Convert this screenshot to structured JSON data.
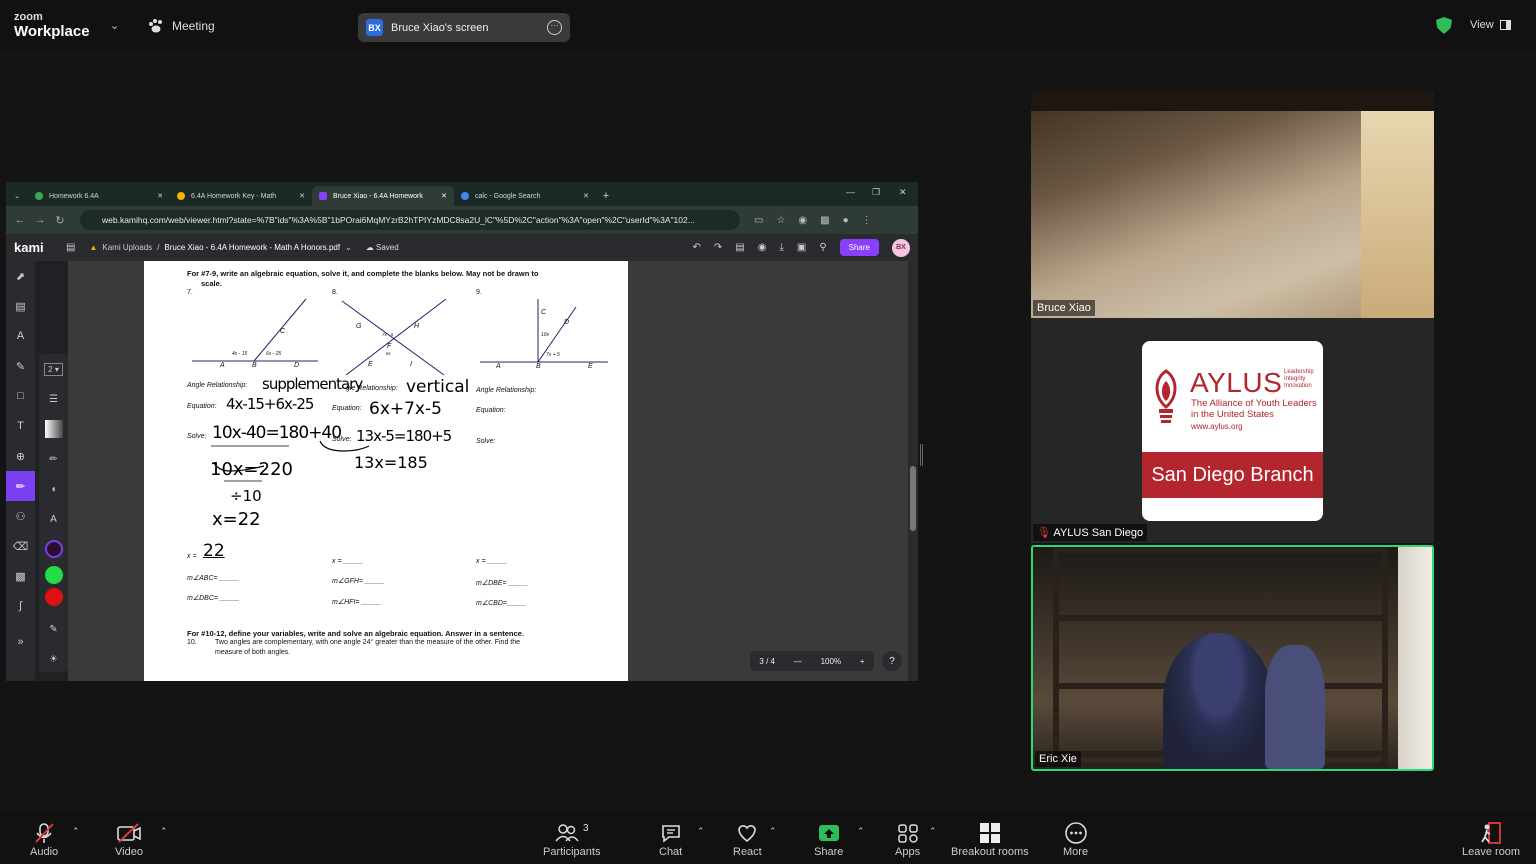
{
  "topbar": {
    "logo_small": "zoom",
    "logo_big": "Workplace",
    "meeting_label": "Meeting",
    "screen_initials": "BX",
    "screen_label": "Bruce Xiao's screen",
    "view_label": "View"
  },
  "browser": {
    "tabs": [
      {
        "label": "Homework 6.4A"
      },
      {
        "label": "6.4A Homework Key - Math"
      },
      {
        "label": "Bruce Xiao - 6.4A Homework"
      },
      {
        "label": "calc - Google Search"
      }
    ],
    "url": "web.kamihq.com/web/viewer.html?state=%7B\"ids\"%3A%5B\"1bPOrai6MqMYzrB2hTPIYzMDC8sa2U_lC\"%5D%2C\"action\"%3A\"open\"%2C\"userId\"%3A\"102..."
  },
  "kami": {
    "logo": "kami",
    "folder": "Kami Uploads",
    "file": "Bruce Xiao - 6.4A Homework - Math A Honors.pdf",
    "saved": "Saved",
    "share": "Share",
    "avatar": "BX",
    "stroke_size": "2",
    "colors": [
      "#2a0e2e",
      "#22dd44",
      "#dd1111"
    ],
    "page_indicator": "3 / 4",
    "zoom": "100%",
    "help": "?"
  },
  "document": {
    "heading": "For #7-9, write an algebraic equation, solve it, and complete the blanks below.  May not be drawn to",
    "heading2": "scale.",
    "nums": [
      "7.",
      "8.",
      "9."
    ],
    "fig7": {
      "left": "4x - 15",
      "right": "6x - 25",
      "pts": [
        "A",
        "B",
        "D",
        "C"
      ]
    },
    "fig8": {
      "top": "7x - 5",
      "bottom": "6x",
      "pts": [
        "G",
        "H",
        "F",
        "E",
        "I"
      ]
    },
    "fig9": {
      "a": "10x",
      "b": "7x + 5",
      "pts": [
        "C",
        "D",
        "A",
        "B",
        "E"
      ]
    },
    "angle_rel": "Angle Relationship:",
    "angle_rel_short": "gle Relationship:",
    "equation": "Equation:",
    "solve": "Solve:",
    "x_eq": "x =",
    "blank": "_____",
    "q7_lines": [
      "m∠ABC= _____",
      "m∠DBC= _____"
    ],
    "q8_lines": [
      "m∠GFH= _____",
      "m∠HFI= _____"
    ],
    "q9_lines": [
      "m∠DBE= _____",
      "m∠CBD=_____"
    ],
    "section2": "For #10-12, define your variables, write and solve an algebraic equation.  Answer in a sentence.",
    "q10_num": "10.",
    "q10_text": "Two angles are complementary, with one angle 24° greater than the measure of the other.  Find the",
    "q10_text2": "measure of both angles.",
    "handwriting": {
      "rel7": "supplementary",
      "rel8": "vertical",
      "eq7": "4x-15+6x-25",
      "eq8": "6x+7x-5",
      "solve7": "10x-40=180+40",
      "solve8": "13x-5=180+5",
      "step7a": "10x=220",
      "step7b": "÷10",
      "step7c": "x=22",
      "step8a": "13x=185",
      "ans7": "22"
    }
  },
  "participants": [
    {
      "name": "Bruce Xiao"
    },
    {
      "name": "AYLUS San Diego"
    },
    {
      "name": "Eric Xie"
    }
  ],
  "aylus": {
    "name": "AYLUS",
    "tagline": [
      "Leadership",
      "Integrity",
      "Innovation"
    ],
    "sub1": "The Alliance of Youth Leaders",
    "sub2": "in the United States",
    "url": "www.aylus.org",
    "branch": "San Diego Branch"
  },
  "toolbar": {
    "audio": "Audio",
    "video": "Video",
    "participants": "Participants",
    "participants_count": "3",
    "chat": "Chat",
    "react": "React",
    "share": "Share",
    "apps": "Apps",
    "breakout": "Breakout rooms",
    "more": "More",
    "leave": "Leave room"
  },
  "colors": {
    "accent_green": "#2bd97a",
    "share_green": "#2ebd59",
    "kami_purple": "#8a3ffc",
    "aylus_red": "#b3262d"
  }
}
